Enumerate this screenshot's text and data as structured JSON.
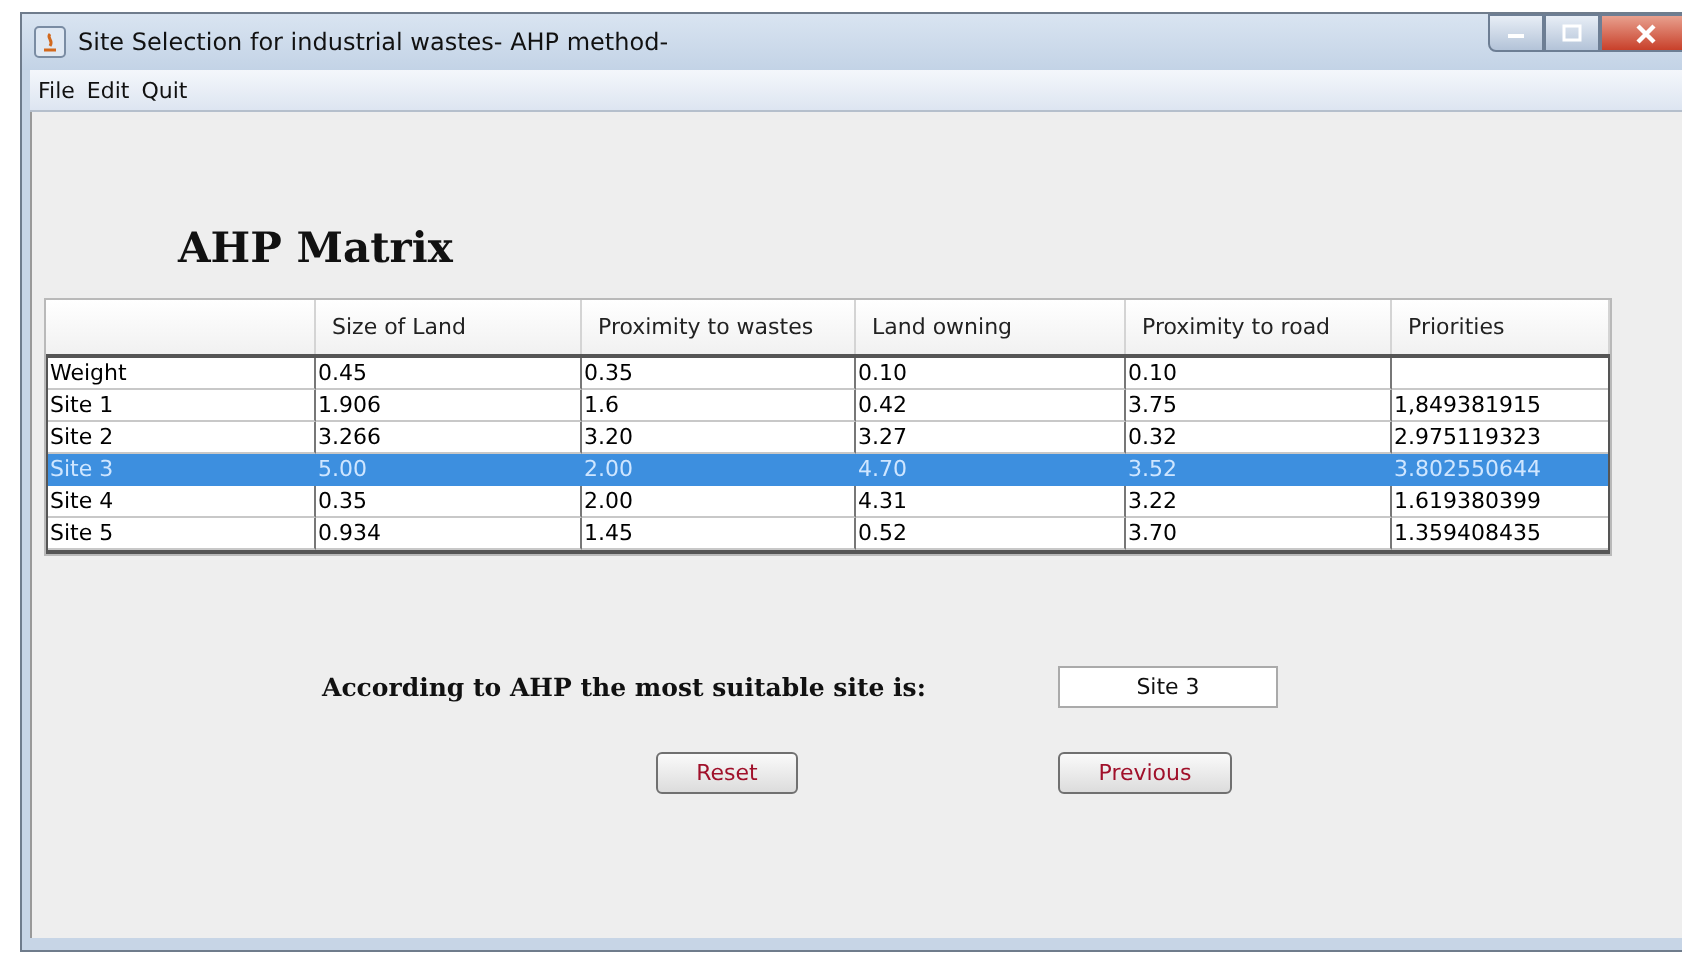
{
  "window": {
    "title": "Site Selection for industrial wastes- AHP method-"
  },
  "menu": [
    "File",
    "Edit",
    "Quit"
  ],
  "heading": "AHP Matrix",
  "table": {
    "columns": [
      "",
      "Size of Land",
      "Proximity to wastes",
      "Land owning",
      "Proximity to road",
      "Priorities"
    ],
    "rows": [
      {
        "cells": [
          "Weight",
          "0.45",
          "0.35",
          "0.10",
          "0.10",
          ""
        ],
        "selected": false
      },
      {
        "cells": [
          "Site 1",
          "1.906",
          "1.6",
          "0.42",
          "3.75",
          "1,849381915"
        ],
        "selected": false
      },
      {
        "cells": [
          "Site 2",
          "3.266",
          "3.20",
          "3.27",
          "0.32",
          "2.975119323"
        ],
        "selected": false
      },
      {
        "cells": [
          "Site 3",
          "5.00",
          "2.00",
          "4.70",
          "3.52",
          "3.802550644"
        ],
        "selected": true
      },
      {
        "cells": [
          "Site 4",
          "0.35",
          "2.00",
          "4.31",
          "3.22",
          "1.619380399"
        ],
        "selected": false
      },
      {
        "cells": [
          "Site 5",
          "0.934",
          "1.45",
          "0.52",
          "3.70",
          "1.359408435"
        ],
        "selected": false
      }
    ]
  },
  "result": {
    "label": "According to AHP the most suitable site is:",
    "value": "Site 3"
  },
  "buttons": [
    "Reset",
    "Previous"
  ]
}
